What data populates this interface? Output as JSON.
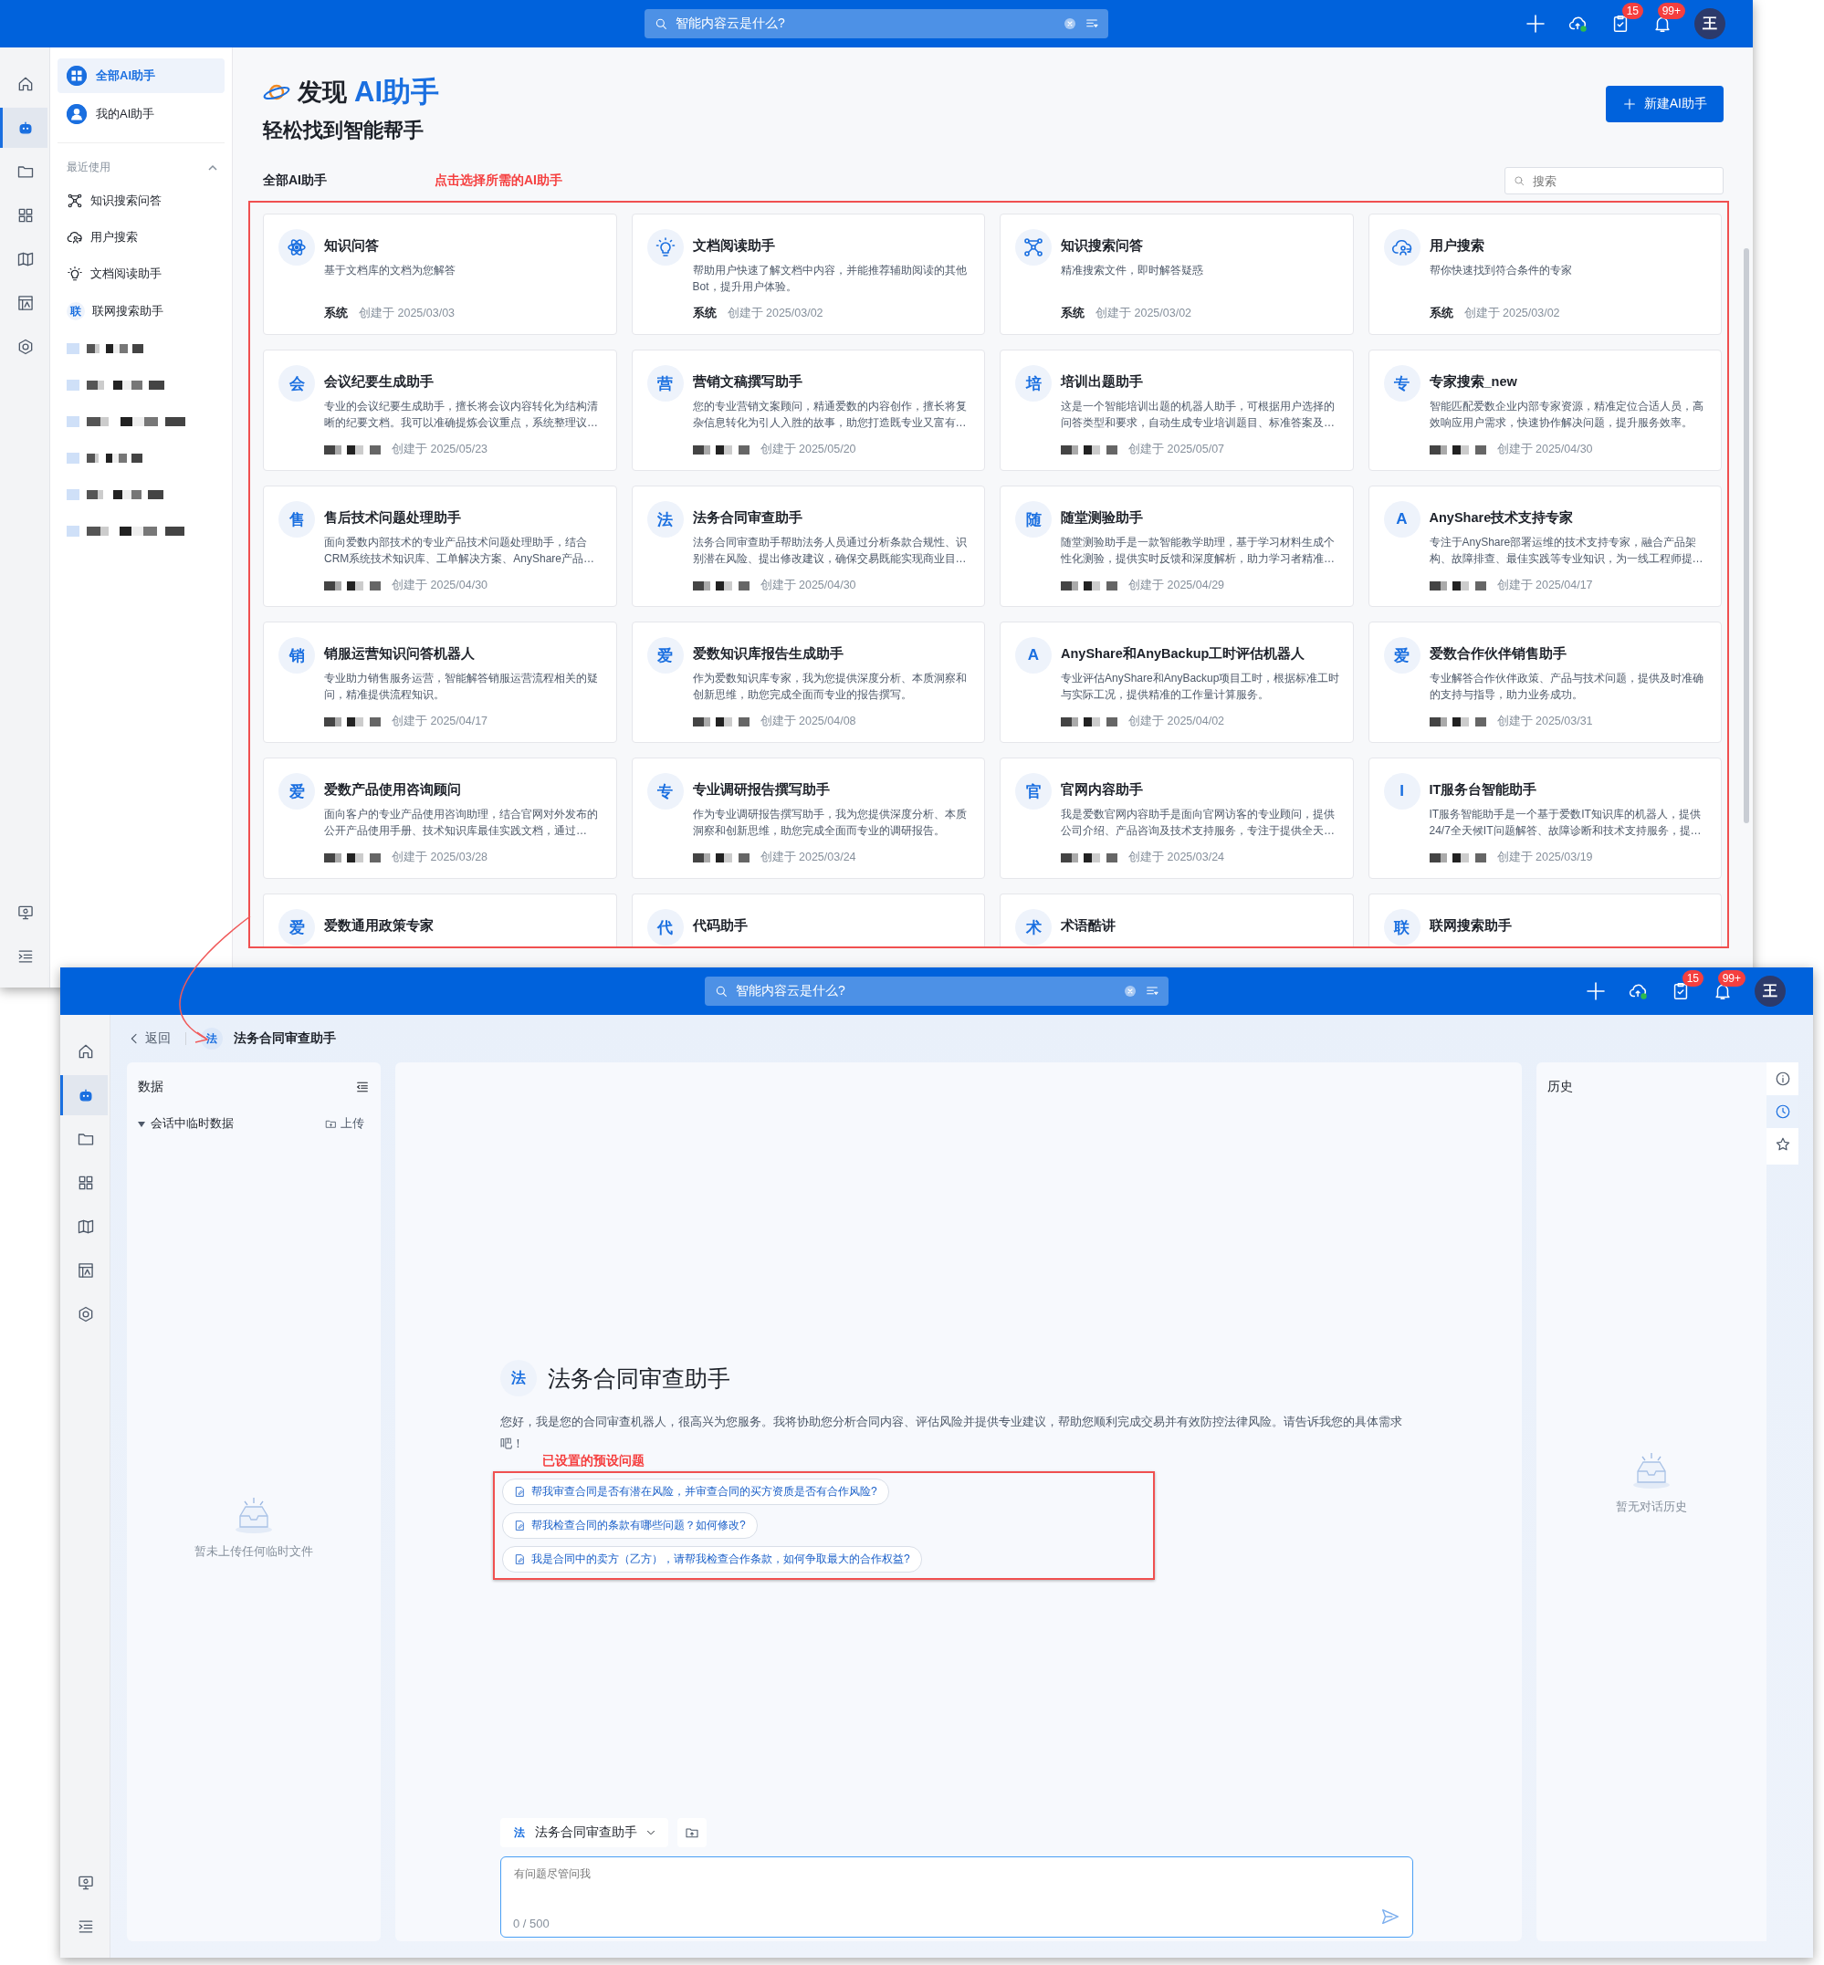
{
  "top_window": {
    "header": {
      "search": "智能内容云是什么?",
      "tasks_badge": "15",
      "notifications_badge": "99+",
      "avatar": "王"
    },
    "rail": [
      {
        "selected": false
      },
      {
        "selected": true
      },
      {
        "selected": false
      },
      {
        "selected": false
      },
      {
        "selected": false
      },
      {
        "selected": false
      },
      {
        "selected": false
      },
      {
        "selected": false
      },
      {
        "selected": false
      }
    ],
    "sidebar": {
      "items": [
        {
          "label": "全部AI助手",
          "selected": true
        },
        {
          "label": "我的AI助手",
          "selected": false
        }
      ],
      "recent_title": "最近使用",
      "recent_expanded": true,
      "recent": [
        {
          "kind": "item",
          "label": "知识搜索问答"
        },
        {
          "kind": "item",
          "label": "用户搜索"
        },
        {
          "kind": "item",
          "label": "文档阅读助手"
        },
        {
          "kind": "item",
          "label": "联网搜索助手",
          "avatar": "联"
        },
        {
          "kind": "redacted"
        },
        {
          "kind": "redacted"
        },
        {
          "kind": "redacted"
        },
        {
          "kind": "redacted"
        },
        {
          "kind": "redacted"
        },
        {
          "kind": "redacted"
        }
      ]
    },
    "heading": {
      "prefix": "发现",
      "highlight": "AI助手",
      "subtitle": "轻松找到智能帮手"
    },
    "new_button": "新建AI助手",
    "section_title": "全部AI助手",
    "annotation": "点击选择所需的AI助手",
    "search_placeholder": "搜索",
    "cards": [
      {
        "title": "知识问答",
        "description": "基于文档库的文档为您解答",
        "creator": "系统",
        "created": "创建于 2025/03/03"
      },
      {
        "title": "文档阅读助手",
        "description": "帮助用户快速了解文档中内容，并能推荐辅助阅读的其他Bot，提升用户体验。",
        "creator": "系统",
        "created": "创建于 2025/03/02"
      },
      {
        "title": "知识搜索问答",
        "description": "精准搜索文件，即时解答疑惑",
        "creator": "系统",
        "created": "创建于 2025/03/02"
      },
      {
        "title": "用户搜索",
        "description": "帮你快速找到符合条件的专家",
        "creator": "系统",
        "created": "创建于 2025/03/02"
      },
      {
        "avatar": "会",
        "title": "会议纪要生成助手",
        "description": "专业的会议纪要生成助手，擅长将会议内容转化为结构清晰的纪要文档。我可以准确提炼会议重点，系统整理议…",
        "created": "创建于 2025/05/23"
      },
      {
        "avatar": "营",
        "title": "营销文稿撰写助手",
        "description": "您的专业营销文案顾问，精通爱数的内容创作，擅长将复杂信息转化为引人入胜的故事，助您打造既专业又富有…",
        "created": "创建于 2025/05/20"
      },
      {
        "avatar": "培",
        "title": "培训出题助手",
        "description": "这是一个智能培训出题的机器人助手，可根据用户选择的问答类型和要求，自动生成专业培训题目、标准答案及…",
        "created": "创建于 2025/05/07"
      },
      {
        "avatar": "专",
        "title": "专家搜索_new",
        "description": "智能匹配爱数企业内部专家资源，精准定位合适人员，高效响应用户需求，快速协作解决问题，提升服务效率。",
        "created": "创建于 2025/04/30"
      },
      {
        "avatar": "售",
        "title": "售后技术问题处理助手",
        "description": "面向爱数内部技术的专业产品技术问题处理助手，结合CRM系统技术知识库、工单解决方案、AnyShare产品…",
        "created": "创建于 2025/04/30"
      },
      {
        "avatar": "法",
        "title": "法务合同审查助手",
        "description": "法务合同审查助手帮助法务人员通过分析条款合规性、识别潜在风险、提出修改建议，确保交易既能实现商业目…",
        "created": "创建于 2025/04/30"
      },
      {
        "avatar": "随",
        "title": "随堂测验助手",
        "description": "随堂测验助手是一款智能教学助理，基于学习材料生成个性化测验，提供实时反馈和深度解析，助力学习者精准…",
        "created": "创建于 2025/04/29"
      },
      {
        "avatar": "A",
        "title": "AnyShare技术支持专家",
        "description": "专注于AnyShare部署运维的技术支持专家，融合产品架构、故障排查、最佳实践等专业知识，为一线工程师提…",
        "created": "创建于 2025/04/17"
      },
      {
        "avatar": "销",
        "title": "销服运营知识问答机器人",
        "description": "专业助力销售服务运营，智能解答销服运营流程相关的疑问，精准提供流程知识。",
        "created": "创建于 2025/04/17"
      },
      {
        "avatar": "爱",
        "title": "爱数知识库报告生成助手",
        "description": "作为爱数知识库专家，我为您提供深度分析、本质洞察和创新思维，助您完成全面而专业的报告撰写。",
        "created": "创建于 2025/04/08"
      },
      {
        "avatar": "A",
        "title": "AnyShare和AnyBackup工时评估机器人",
        "description": "专业评估AnyShare和AnyBackup项目工时，根据标准工时与实际工况，提供精准的工作量计算服务。",
        "created": "创建于 2025/04/02"
      },
      {
        "avatar": "爱",
        "title": "爱数合作伙伴销售助手",
        "description": "专业解答合作伙伴政策、产品与技术问题，提供及时准确的支持与指导，助力业务成功。",
        "created": "创建于 2025/03/31"
      },
      {
        "avatar": "爱",
        "title": "爱数产品使用咨询顾问",
        "description": "面向客户的专业产品使用咨询助理，结合官网对外发布的公开产品使用手册、技术知识库最佳实践文档，通过…",
        "created": "创建于 2025/03/28"
      },
      {
        "avatar": "专",
        "title": "专业调研报告撰写助手",
        "description": "作为专业调研报告撰写助手，我为您提供深度分析、本质洞察和创新思维，助您完成全面而专业的调研报告。",
        "created": "创建于 2025/03/24"
      },
      {
        "avatar": "官",
        "title": "官网内容助手",
        "description": "我是爱数官网内容助手是面向官网访客的专业顾问，提供公司介绍、产品咨询及技术支持服务，专注于提供全天…",
        "created": "创建于 2025/03/24"
      },
      {
        "avatar": "I",
        "title": "IT服务台智能助手",
        "description": "IT服务智能助手是一个基于爱数IT知识库的机器人，提供24/7全天候IT问题解答、故障诊断和技术支持服务，提…",
        "created": "创建于 2025/03/19"
      },
      {
        "avatar": "爱",
        "title": "爱数通用政策专家"
      },
      {
        "avatar": "代",
        "title": "代码助手"
      },
      {
        "avatar": "术",
        "title": "术语酷讲"
      },
      {
        "avatar": "联",
        "title": "联网搜索助手"
      }
    ]
  },
  "bottom_window": {
    "header": {
      "search": "智能内容云是什么?",
      "tasks_badge": "15",
      "notifications_badge": "99+",
      "avatar": "王"
    },
    "rail": [
      {
        "selected": false
      },
      {
        "selected": true
      },
      {
        "selected": false
      },
      {
        "selected": false
      },
      {
        "selected": false
      },
      {
        "selected": false
      },
      {
        "selected": false
      },
      {
        "selected": false
      },
      {
        "selected": false
      }
    ],
    "back": "返回",
    "assistant": {
      "avatar": "法",
      "name": "法务合同审查助手"
    },
    "data_panel": {
      "title": "数据",
      "folder": {
        "label": "会话中临时数据",
        "expanded": true
      },
      "upload": "上传",
      "empty": "暂未上传任何临时文件"
    },
    "chat": {
      "avatar": "法",
      "title": "法务合同审查助手",
      "greeting": "您好，我是您的合同审查机器人，很高兴为您服务。我将协助您分析合同内容、评估风险并提供专业建议，帮助您顺利完成交易并有效防控法律风险。请告诉我您的具体需求吧！",
      "annotation": "已设置的预设问题",
      "presets": [
        "帮我审查合同是否有潜在风险，并审查合同的买方资质是否有合作风险?",
        "帮我检查合同的条款有哪些问题？如何修改?",
        "我是合同中的卖方（乙方），请帮我检查合作条款，如何争取最大的合作权益?"
      ],
      "selector": {
        "avatar": "法",
        "name": "法务合同审查助手"
      },
      "input": {
        "placeholder": "有问题尽管问我",
        "counter": "0 / 500"
      }
    },
    "history": {
      "title": "历史",
      "empty": "暂无对话历史"
    },
    "side_tabs": [
      {
        "selected": false
      },
      {
        "selected": true
      },
      {
        "selected": false
      }
    ]
  }
}
